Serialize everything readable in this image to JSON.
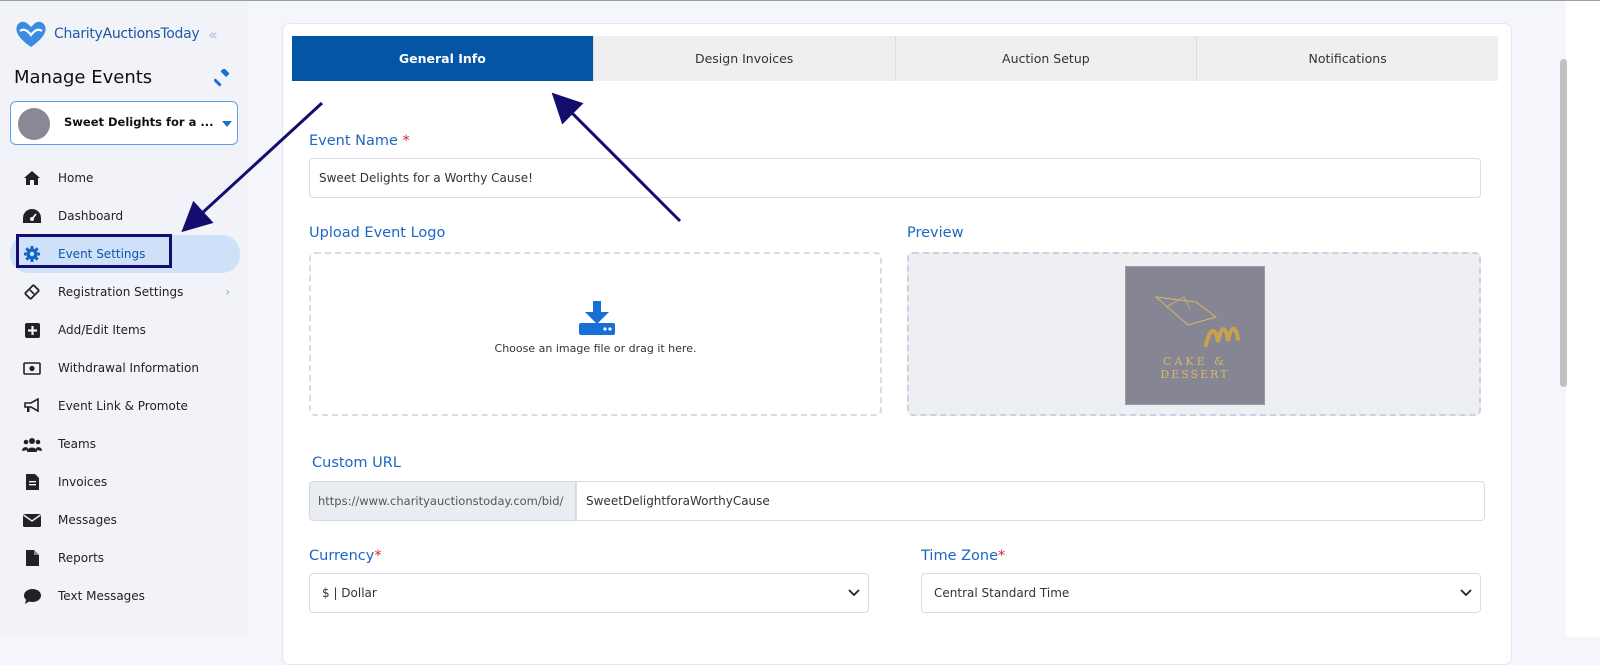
{
  "brand": {
    "name_part1": "Charity",
    "name_part2": "Auctions",
    "name_part3": "Today"
  },
  "sidebar": {
    "title": "Manage Events",
    "event_picker": {
      "name": "Sweet Delights for a ..."
    },
    "items": [
      {
        "label": "Home",
        "icon": "home-icon"
      },
      {
        "label": "Dashboard",
        "icon": "gauge-icon"
      },
      {
        "label": "Event Settings",
        "icon": "gear-icon",
        "active": true
      },
      {
        "label": "Registration Settings",
        "icon": "ticket-icon",
        "chevron": true
      },
      {
        "label": "Add/Edit Items",
        "icon": "plus-square-icon"
      },
      {
        "label": "Withdrawal Information",
        "icon": "money-bill-icon"
      },
      {
        "label": "Event Link & Promote",
        "icon": "megaphone-icon"
      },
      {
        "label": "Teams",
        "icon": "users-icon"
      },
      {
        "label": "Invoices",
        "icon": "file-invoice-icon"
      },
      {
        "label": "Messages",
        "icon": "envelope-icon"
      },
      {
        "label": "Reports",
        "icon": "file-icon"
      },
      {
        "label": "Text Messages",
        "icon": "comment-icon"
      }
    ]
  },
  "tabs": [
    {
      "label": "General Info",
      "active": true
    },
    {
      "label": "Design Invoices"
    },
    {
      "label": "Auction Setup"
    },
    {
      "label": "Notifications"
    }
  ],
  "form": {
    "event_name": {
      "label": "Event Name",
      "required": "*",
      "value": "Sweet Delights for a Worthy Cause!"
    },
    "upload_logo": {
      "label": "Upload Event Logo",
      "hint": "Choose an image file or drag it here."
    },
    "preview": {
      "label": "Preview",
      "logo_line1": "CAKE &",
      "logo_line2": "DESSERT"
    },
    "custom_url": {
      "label": "Custom URL",
      "prefix": "https://www.charityauctionstoday.com/bid/",
      "value": "SweetDelightforaWorthyCause"
    },
    "currency": {
      "label": "Currency",
      "required": "*",
      "value": "$ | Dollar"
    },
    "time_zone": {
      "label": "Time Zone",
      "required": "*",
      "value": "Central Standard Time"
    }
  },
  "colors": {
    "accent": "#0356a6",
    "label_blue": "#1d67c4",
    "annotation_navy": "#140c6e",
    "required_red": "#d8232a"
  }
}
